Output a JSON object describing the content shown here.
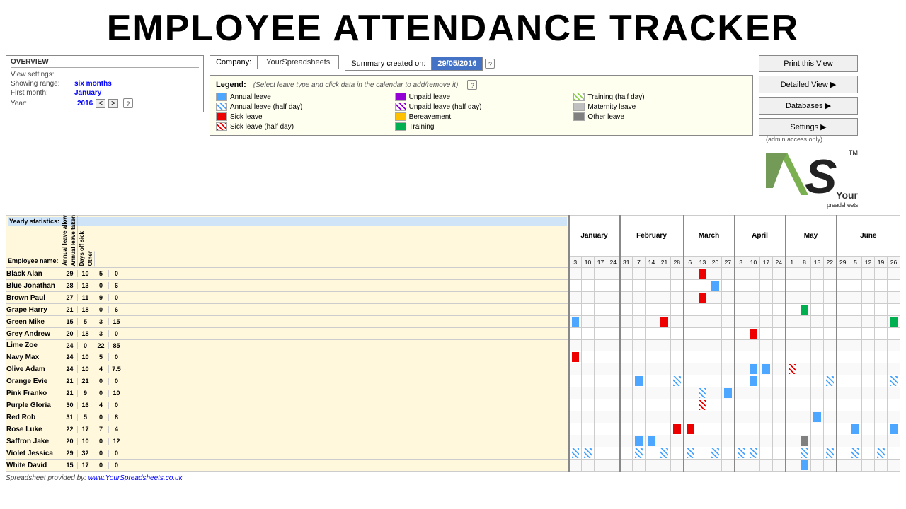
{
  "title": "EMPLOYEE ATTENDANCE TRACKER",
  "overview": {
    "label": "OVERVIEW",
    "view_settings_label": "View settings:",
    "showing_range_label": "Showing range:",
    "showing_range_value": "six months",
    "first_month_label": "First month:",
    "first_month_value": "January",
    "year_label": "Year:",
    "year_value": "2016"
  },
  "company": {
    "label": "Company:",
    "value": "YourSpreadsheets"
  },
  "summary": {
    "label": "Summary created on:",
    "value": "29/05/2016"
  },
  "legend": {
    "title": "Legend:",
    "hint": "(Select leave type and click data in the calendar to add/remove it)",
    "items": [
      {
        "color": "annual-leave",
        "label": "Annual leave"
      },
      {
        "color": "unpaid",
        "label": "Unpaid leave"
      },
      {
        "color": "training-half",
        "label": "Training (half day)"
      },
      {
        "color": "annual-half",
        "label": "Annual leave (half day)"
      },
      {
        "color": "unpaid-half",
        "label": "Unpaid leave (half day)"
      },
      {
        "color": "maternity",
        "label": "Maternity leave"
      },
      {
        "color": "sick-leave",
        "label": "Sick leave"
      },
      {
        "color": "bereavement",
        "label": "Bereavement"
      },
      {
        "color": "other-leave",
        "label": "Other leave"
      },
      {
        "color": "sick-half",
        "label": "Sick leave (half day)"
      },
      {
        "color": "training",
        "label": "Training"
      }
    ]
  },
  "buttons": {
    "print": "Print this View",
    "detailed": "Detailed View ▶",
    "databases": "Databases ▶",
    "settings": "Settings ▶",
    "settings_sub": "(admin access only)"
  },
  "yearly_stats": "Yearly statistics:",
  "headers": {
    "employee_name": "Employee name:",
    "annual_allowance": "Annual leave allowance",
    "annual_taken": "Annual leave taken",
    "days_off_sick": "Days off sick",
    "other": "Other"
  },
  "months": [
    "January",
    "February",
    "March",
    "April",
    "May",
    "June"
  ],
  "month_dates": {
    "January": [
      3,
      10,
      17,
      24
    ],
    "February": [
      31,
      7,
      14,
      21,
      28
    ],
    "March": [
      6,
      13,
      20,
      27
    ],
    "April": [
      3,
      10,
      17,
      24
    ],
    "May": [
      1,
      8,
      15,
      22
    ],
    "June": [
      29,
      5,
      12,
      19,
      26
    ]
  },
  "employees": [
    {
      "name": "Black Alan",
      "allowance": 29,
      "taken": 10,
      "sick": 5,
      "other": 0,
      "leaves": {
        "mar": [
          13
        ],
        "apr": [],
        "may": []
      }
    },
    {
      "name": "Blue Jonathan",
      "allowance": 28,
      "taken": 13,
      "sick": 0,
      "other": 6,
      "leaves": {}
    },
    {
      "name": "Brown Paul",
      "allowance": 27,
      "taken": 11,
      "sick": 9,
      "other": 0
    },
    {
      "name": "Grape Harry",
      "allowance": 21,
      "taken": 18,
      "sick": 0,
      "other": 6
    },
    {
      "name": "Green Mike",
      "allowance": 15,
      "taken": 5,
      "sick": 3,
      "other": 15
    },
    {
      "name": "Grey Andrew",
      "allowance": 20,
      "taken": 18,
      "sick": 3,
      "other": 0
    },
    {
      "name": "Lime Zoe",
      "allowance": 24,
      "taken": 0,
      "sick": 22,
      "other": 85
    },
    {
      "name": "Navy Max",
      "allowance": 24,
      "taken": 10,
      "sick": 5,
      "other": 0
    },
    {
      "name": "Olive Adam",
      "allowance": 24,
      "taken": 10,
      "sick": 4,
      "other": 7.5
    },
    {
      "name": "Orange Evie",
      "allowance": 21,
      "taken": 21,
      "sick": 0,
      "other": 0
    },
    {
      "name": "Pink Franko",
      "allowance": 21,
      "taken": 9,
      "sick": 0,
      "other": 10
    },
    {
      "name": "Purple Gloria",
      "allowance": 30,
      "taken": 16,
      "sick": 4,
      "other": 0
    },
    {
      "name": "Red Rob",
      "allowance": 31,
      "taken": 5,
      "sick": 0,
      "other": 8
    },
    {
      "name": "Rose Luke",
      "allowance": 22,
      "taken": 17,
      "sick": 7,
      "other": 4
    },
    {
      "name": "Saffron Jake",
      "allowance": 20,
      "taken": 10,
      "sick": 0,
      "other": 12
    },
    {
      "name": "Violet Jessica",
      "allowance": 29,
      "taken": 32,
      "sick": 0,
      "other": 0
    },
    {
      "name": "White David",
      "allowance": 15,
      "taken": 17,
      "sick": 0,
      "other": 0
    }
  ],
  "footer": {
    "provided_by": "Spreadsheet provided by:",
    "link": "www.YourSpreadsheets.co.uk"
  }
}
